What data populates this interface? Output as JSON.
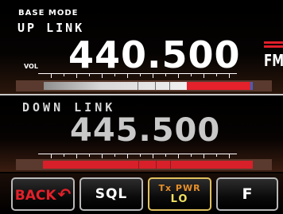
{
  "mode": "BASE MODE",
  "uplink": {
    "label": "UP LINK",
    "frequency": "440.500",
    "vol_label": "VOL",
    "modulation": "FM"
  },
  "downlink": {
    "label": "DOWN LINK",
    "frequency": "445.500"
  },
  "buttons": {
    "back": "BACK",
    "sql": "SQL",
    "txpwr_top": "Tx PWR",
    "txpwr_bottom": "LO",
    "f": "F"
  },
  "colors": {
    "accent_red": "#e3222c",
    "txpwr_label": "#e6902a",
    "txpwr_value": "#f0e060"
  }
}
